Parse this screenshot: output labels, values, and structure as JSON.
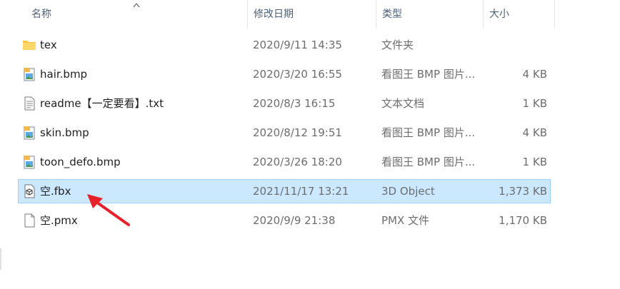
{
  "columns": {
    "name": "名称",
    "date": "修改日期",
    "type": "类型",
    "size": "大小"
  },
  "files": [
    {
      "name": "tex",
      "date": "2020/9/11 14:35",
      "type": "文件夹",
      "size": "",
      "icon": "folder-icon"
    },
    {
      "name": "hair.bmp",
      "date": "2020/3/20 16:55",
      "type": "看图王 BMP 图片...",
      "size": "4 KB",
      "icon": "image-file-icon"
    },
    {
      "name": "readme【一定要看】.txt",
      "date": "2020/8/3 16:15",
      "type": "文本文档",
      "size": "1 KB",
      "icon": "text-file-icon"
    },
    {
      "name": "skin.bmp",
      "date": "2020/8/12 19:51",
      "type": "看图王 BMP 图片...",
      "size": "4 KB",
      "icon": "image-file-icon"
    },
    {
      "name": "toon_defo.bmp",
      "date": "2020/3/26 18:20",
      "type": "看图王 BMP 图片...",
      "size": "1 KB",
      "icon": "image-file-icon"
    },
    {
      "name": "空.fbx",
      "date": "2021/11/17 13:21",
      "type": "3D Object",
      "size": "1,373 KB",
      "icon": "3d-object-file-icon",
      "selected": true
    },
    {
      "name": "空.pmx",
      "date": "2020/9/9 21:38",
      "type": "PMX 文件",
      "size": "1,170 KB",
      "icon": "blank-file-icon"
    }
  ],
  "colors": {
    "selection_bg": "#cce8ff",
    "selection_border": "#99d1ff",
    "annotation_arrow": "#e8202a",
    "folder": "#f8c342"
  },
  "annotation": {
    "icon": "red-arrow-icon"
  }
}
